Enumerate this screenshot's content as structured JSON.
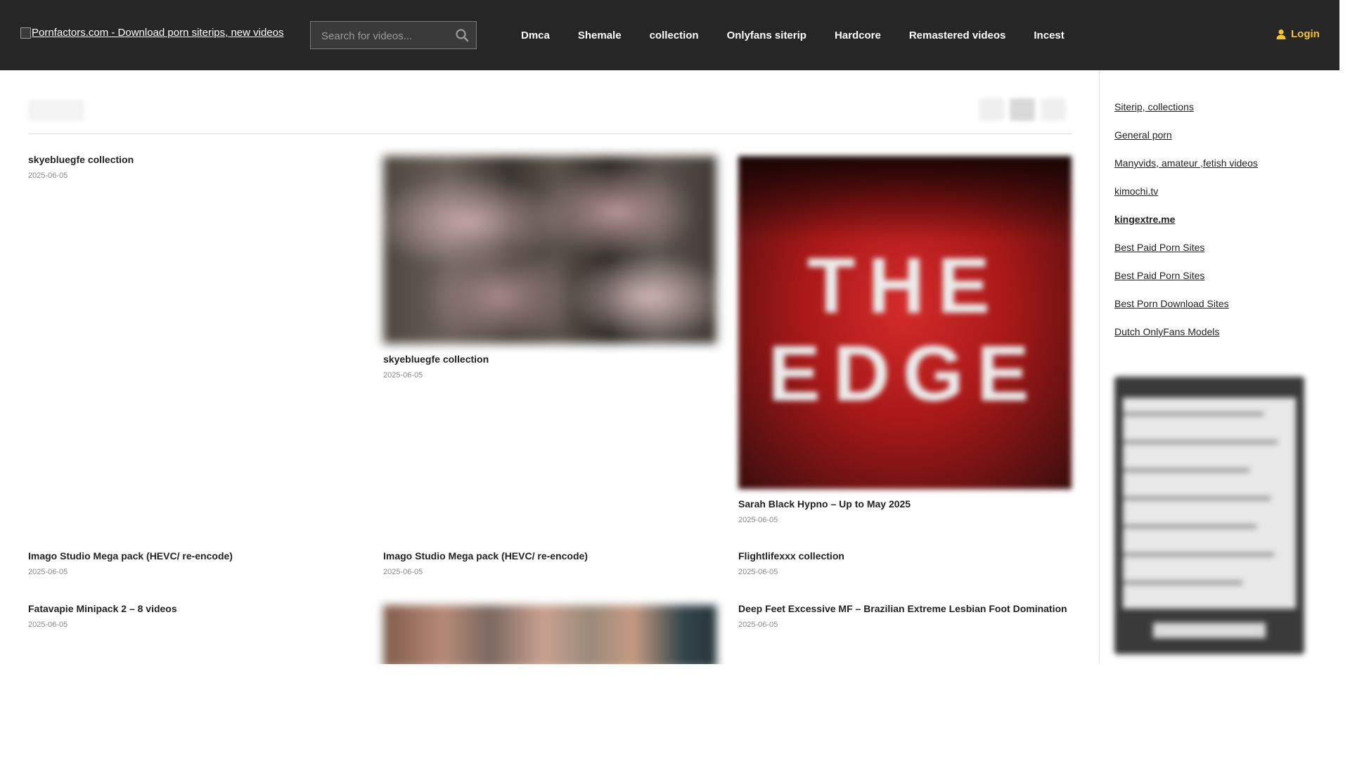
{
  "header": {
    "logo_alt": "Pornfactors.com - Download porn siterips, new videos",
    "search": {
      "placeholder": "Search for videos..."
    },
    "nav": [
      "Dmca",
      "Shemale",
      "collection",
      "Onlyfans siterip",
      "Hardcore",
      "Remastered videos",
      "Incest"
    ],
    "login_label": "Login"
  },
  "posts": [
    {
      "title": "skyebluegfe collection",
      "date": "2025-06-05",
      "thumb": "none"
    },
    {
      "title": "skyebluegfe collection",
      "date": "2025-06-05",
      "thumb": "collage"
    },
    {
      "title": "Sarah Black Hypno – Up to May 2025",
      "date": "2025-06-05",
      "thumb": "the-edge-cover",
      "cover_text": [
        "THE",
        "EDGE"
      ]
    },
    {
      "title": "Imago Studio Mega pack (HEVC/ re-encode)",
      "date": "2025-06-05",
      "thumb": "none"
    },
    {
      "title": "Imago Studio Mega pack (HEVC/ re-encode)",
      "date": "2025-06-05",
      "thumb": "none"
    },
    {
      "title": "Flightlifexxx collection",
      "date": "2025-06-05",
      "thumb": "none"
    },
    {
      "title": "Fatavapie Minipack 2 – 8 videos",
      "date": "2025-06-05",
      "thumb": "none"
    },
    {
      "title": "",
      "date": "",
      "thumb": "blurred-photo"
    },
    {
      "title": "Deep Feet Excessive MF – Brazilian Extreme Lesbian Foot Domination",
      "date": "2025-06-05",
      "thumb": "none"
    }
  ],
  "sidebar": {
    "links": [
      {
        "label": "Siterip, collections",
        "bold": false
      },
      {
        "label": "General porn",
        "bold": false
      },
      {
        "label": "Manyvids, amateur ,fetish videos",
        "bold": false
      },
      {
        "label": "kimochi.tv",
        "bold": false
      },
      {
        "label": "kingextre.me",
        "bold": true
      },
      {
        "label": "Best Paid Porn Sites",
        "bold": false
      },
      {
        "label": "Best Paid Porn Sites",
        "bold": false
      },
      {
        "label": "Best Porn Download Sites",
        "bold": false
      },
      {
        "label": "Dutch OnlyFans Models",
        "bold": false
      }
    ]
  },
  "colors": {
    "header_bg": "#262626",
    "login_accent": "#f4c430",
    "date_text": "#8a8a8a"
  },
  "icons": {
    "search": "search-icon",
    "user": "user-icon"
  }
}
